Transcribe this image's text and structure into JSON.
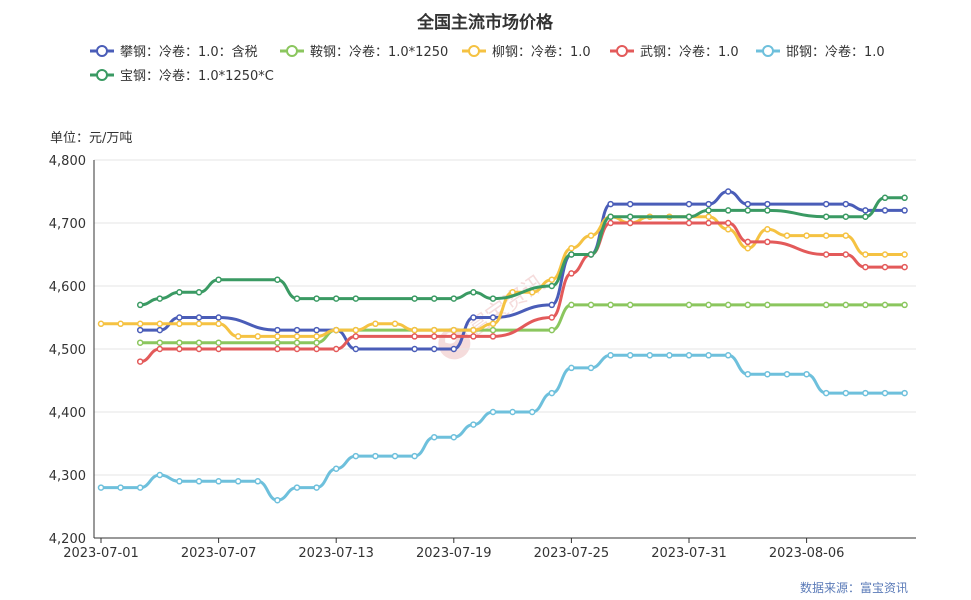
{
  "chart_data": {
    "type": "line",
    "title": "全国主流市场价格",
    "ylabel": "单位：元/万吨",
    "ylim": [
      4200,
      4800
    ],
    "yticks": [
      "4,200",
      "4,300",
      "4,400",
      "4,500",
      "4,600",
      "4,700",
      "4,800"
    ],
    "xticks": [
      "2023-07-01",
      "2023-07-07",
      "2023-07-13",
      "2023-07-19",
      "2023-07-25",
      "2023-07-31",
      "2023-08-06"
    ],
    "x_start": "2023-07-01",
    "source": "数据来源：富宝资讯",
    "watermark": "富宝资讯",
    "grid": "horizontal",
    "legend_position": "top-left",
    "series": [
      {
        "name": "攀钢：冷卷：1.0：含税",
        "color": "#4a5db8",
        "points": [
          [
            "2023-07-03",
            4530
          ],
          [
            "2023-07-04",
            4530
          ],
          [
            "2023-07-05",
            4550
          ],
          [
            "2023-07-06",
            4550
          ],
          [
            "2023-07-07",
            4550
          ],
          [
            "2023-07-10",
            4530
          ],
          [
            "2023-07-11",
            4530
          ],
          [
            "2023-07-12",
            4530
          ],
          [
            "2023-07-13",
            4530
          ],
          [
            "2023-07-14",
            4500
          ],
          [
            "2023-07-17",
            4500
          ],
          [
            "2023-07-18",
            4500
          ],
          [
            "2023-07-19",
            4500
          ],
          [
            "2023-07-20",
            4550
          ],
          [
            "2023-07-21",
            4550
          ],
          [
            "2023-07-24",
            4570
          ],
          [
            "2023-07-25",
            4650
          ],
          [
            "2023-07-26",
            4650
          ],
          [
            "2023-07-27",
            4730
          ],
          [
            "2023-07-28",
            4730
          ],
          [
            "2023-07-31",
            4730
          ],
          [
            "2023-08-01",
            4730
          ],
          [
            "2023-08-02",
            4750
          ],
          [
            "2023-08-03",
            4730
          ],
          [
            "2023-08-04",
            4730
          ],
          [
            "2023-08-07",
            4730
          ],
          [
            "2023-08-08",
            4730
          ],
          [
            "2023-08-09",
            4720
          ],
          [
            "2023-08-10",
            4720
          ],
          [
            "2023-08-11",
            4720
          ]
        ]
      },
      {
        "name": "鞍钢：冷卷：1.0*1250",
        "color": "#8bc65e",
        "points": [
          [
            "2023-07-03",
            4510
          ],
          [
            "2023-07-04",
            4510
          ],
          [
            "2023-07-05",
            4510
          ],
          [
            "2023-07-06",
            4510
          ],
          [
            "2023-07-07",
            4510
          ],
          [
            "2023-07-10",
            4510
          ],
          [
            "2023-07-11",
            4510
          ],
          [
            "2023-07-12",
            4510
          ],
          [
            "2023-07-13",
            4530
          ],
          [
            "2023-07-14",
            4530
          ],
          [
            "2023-07-17",
            4530
          ],
          [
            "2023-07-18",
            4530
          ],
          [
            "2023-07-19",
            4530
          ],
          [
            "2023-07-20",
            4530
          ],
          [
            "2023-07-21",
            4530
          ],
          [
            "2023-07-24",
            4530
          ],
          [
            "2023-07-25",
            4570
          ],
          [
            "2023-07-26",
            4570
          ],
          [
            "2023-07-27",
            4570
          ],
          [
            "2023-07-28",
            4570
          ],
          [
            "2023-07-31",
            4570
          ],
          [
            "2023-08-01",
            4570
          ],
          [
            "2023-08-02",
            4570
          ],
          [
            "2023-08-03",
            4570
          ],
          [
            "2023-08-04",
            4570
          ],
          [
            "2023-08-07",
            4570
          ],
          [
            "2023-08-08",
            4570
          ],
          [
            "2023-08-09",
            4570
          ],
          [
            "2023-08-10",
            4570
          ],
          [
            "2023-08-11",
            4570
          ]
        ]
      },
      {
        "name": "柳钢：冷卷：1.0",
        "color": "#f5c242",
        "points": [
          [
            "2023-07-01",
            4540
          ],
          [
            "2023-07-02",
            4540
          ],
          [
            "2023-07-03",
            4540
          ],
          [
            "2023-07-04",
            4540
          ],
          [
            "2023-07-05",
            4540
          ],
          [
            "2023-07-06",
            4540
          ],
          [
            "2023-07-07",
            4540
          ],
          [
            "2023-07-08",
            4520
          ],
          [
            "2023-07-09",
            4520
          ],
          [
            "2023-07-10",
            4520
          ],
          [
            "2023-07-11",
            4520
          ],
          [
            "2023-07-12",
            4520
          ],
          [
            "2023-07-13",
            4530
          ],
          [
            "2023-07-14",
            4530
          ],
          [
            "2023-07-15",
            4540
          ],
          [
            "2023-07-16",
            4540
          ],
          [
            "2023-07-17",
            4530
          ],
          [
            "2023-07-18",
            4530
          ],
          [
            "2023-07-19",
            4530
          ],
          [
            "2023-07-20",
            4530
          ],
          [
            "2023-07-21",
            4540
          ],
          [
            "2023-07-22",
            4590
          ],
          [
            "2023-07-23",
            4590
          ],
          [
            "2023-07-24",
            4610
          ],
          [
            "2023-07-25",
            4660
          ],
          [
            "2023-07-26",
            4680
          ],
          [
            "2023-07-27",
            4710
          ],
          [
            "2023-07-28",
            4700
          ],
          [
            "2023-07-29",
            4710
          ],
          [
            "2023-07-30",
            4710
          ],
          [
            "2023-07-31",
            4710
          ],
          [
            "2023-08-01",
            4710
          ],
          [
            "2023-08-02",
            4690
          ],
          [
            "2023-08-03",
            4660
          ],
          [
            "2023-08-04",
            4690
          ],
          [
            "2023-08-05",
            4680
          ],
          [
            "2023-08-06",
            4680
          ],
          [
            "2023-08-07",
            4680
          ],
          [
            "2023-08-08",
            4680
          ],
          [
            "2023-08-09",
            4650
          ],
          [
            "2023-08-10",
            4650
          ],
          [
            "2023-08-11",
            4650
          ]
        ]
      },
      {
        "name": "武钢：冷卷：1.0",
        "color": "#e35a5a",
        "points": [
          [
            "2023-07-03",
            4480
          ],
          [
            "2023-07-04",
            4500
          ],
          [
            "2023-07-05",
            4500
          ],
          [
            "2023-07-06",
            4500
          ],
          [
            "2023-07-07",
            4500
          ],
          [
            "2023-07-10",
            4500
          ],
          [
            "2023-07-11",
            4500
          ],
          [
            "2023-07-12",
            4500
          ],
          [
            "2023-07-13",
            4500
          ],
          [
            "2023-07-14",
            4520
          ],
          [
            "2023-07-17",
            4520
          ],
          [
            "2023-07-18",
            4520
          ],
          [
            "2023-07-19",
            4520
          ],
          [
            "2023-07-20",
            4520
          ],
          [
            "2023-07-21",
            4520
          ],
          [
            "2023-07-24",
            4550
          ],
          [
            "2023-07-25",
            4620
          ],
          [
            "2023-07-26",
            4650
          ],
          [
            "2023-07-27",
            4700
          ],
          [
            "2023-07-28",
            4700
          ],
          [
            "2023-07-31",
            4700
          ],
          [
            "2023-08-01",
            4700
          ],
          [
            "2023-08-02",
            4700
          ],
          [
            "2023-08-03",
            4670
          ],
          [
            "2023-08-04",
            4670
          ],
          [
            "2023-08-07",
            4650
          ],
          [
            "2023-08-08",
            4650
          ],
          [
            "2023-08-09",
            4630
          ],
          [
            "2023-08-10",
            4630
          ],
          [
            "2023-08-11",
            4630
          ]
        ]
      },
      {
        "name": "邯钢：冷卷：1.0",
        "color": "#6ec0dc",
        "points": [
          [
            "2023-07-01",
            4280
          ],
          [
            "2023-07-02",
            4280
          ],
          [
            "2023-07-03",
            4280
          ],
          [
            "2023-07-04",
            4300
          ],
          [
            "2023-07-05",
            4290
          ],
          [
            "2023-07-06",
            4290
          ],
          [
            "2023-07-07",
            4290
          ],
          [
            "2023-07-08",
            4290
          ],
          [
            "2023-07-09",
            4290
          ],
          [
            "2023-07-10",
            4260
          ],
          [
            "2023-07-11",
            4280
          ],
          [
            "2023-07-12",
            4280
          ],
          [
            "2023-07-13",
            4310
          ],
          [
            "2023-07-14",
            4330
          ],
          [
            "2023-07-15",
            4330
          ],
          [
            "2023-07-16",
            4330
          ],
          [
            "2023-07-17",
            4330
          ],
          [
            "2023-07-18",
            4360
          ],
          [
            "2023-07-19",
            4360
          ],
          [
            "2023-07-20",
            4380
          ],
          [
            "2023-07-21",
            4400
          ],
          [
            "2023-07-22",
            4400
          ],
          [
            "2023-07-23",
            4400
          ],
          [
            "2023-07-24",
            4430
          ],
          [
            "2023-07-25",
            4470
          ],
          [
            "2023-07-26",
            4470
          ],
          [
            "2023-07-27",
            4490
          ],
          [
            "2023-07-28",
            4490
          ],
          [
            "2023-07-29",
            4490
          ],
          [
            "2023-07-30",
            4490
          ],
          [
            "2023-07-31",
            4490
          ],
          [
            "2023-08-01",
            4490
          ],
          [
            "2023-08-02",
            4490
          ],
          [
            "2023-08-03",
            4460
          ],
          [
            "2023-08-04",
            4460
          ],
          [
            "2023-08-05",
            4460
          ],
          [
            "2023-08-06",
            4460
          ],
          [
            "2023-08-07",
            4430
          ],
          [
            "2023-08-08",
            4430
          ],
          [
            "2023-08-09",
            4430
          ],
          [
            "2023-08-10",
            4430
          ],
          [
            "2023-08-11",
            4430
          ]
        ]
      },
      {
        "name": "宝钢：冷卷：1.0*1250*C",
        "color": "#3a9a63",
        "points": [
          [
            "2023-07-03",
            4570
          ],
          [
            "2023-07-04",
            4580
          ],
          [
            "2023-07-05",
            4590
          ],
          [
            "2023-07-06",
            4590
          ],
          [
            "2023-07-07",
            4610
          ],
          [
            "2023-07-10",
            4610
          ],
          [
            "2023-07-11",
            4580
          ],
          [
            "2023-07-12",
            4580
          ],
          [
            "2023-07-13",
            4580
          ],
          [
            "2023-07-14",
            4580
          ],
          [
            "2023-07-17",
            4580
          ],
          [
            "2023-07-18",
            4580
          ],
          [
            "2023-07-19",
            4580
          ],
          [
            "2023-07-20",
            4590
          ],
          [
            "2023-07-21",
            4580
          ],
          [
            "2023-07-24",
            4600
          ],
          [
            "2023-07-25",
            4650
          ],
          [
            "2023-07-26",
            4650
          ],
          [
            "2023-07-27",
            4710
          ],
          [
            "2023-07-28",
            4710
          ],
          [
            "2023-07-31",
            4710
          ],
          [
            "2023-08-01",
            4720
          ],
          [
            "2023-08-02",
            4720
          ],
          [
            "2023-08-03",
            4720
          ],
          [
            "2023-08-04",
            4720
          ],
          [
            "2023-08-07",
            4710
          ],
          [
            "2023-08-08",
            4710
          ],
          [
            "2023-08-09",
            4710
          ],
          [
            "2023-08-10",
            4740
          ],
          [
            "2023-08-11",
            4740
          ]
        ]
      }
    ]
  }
}
